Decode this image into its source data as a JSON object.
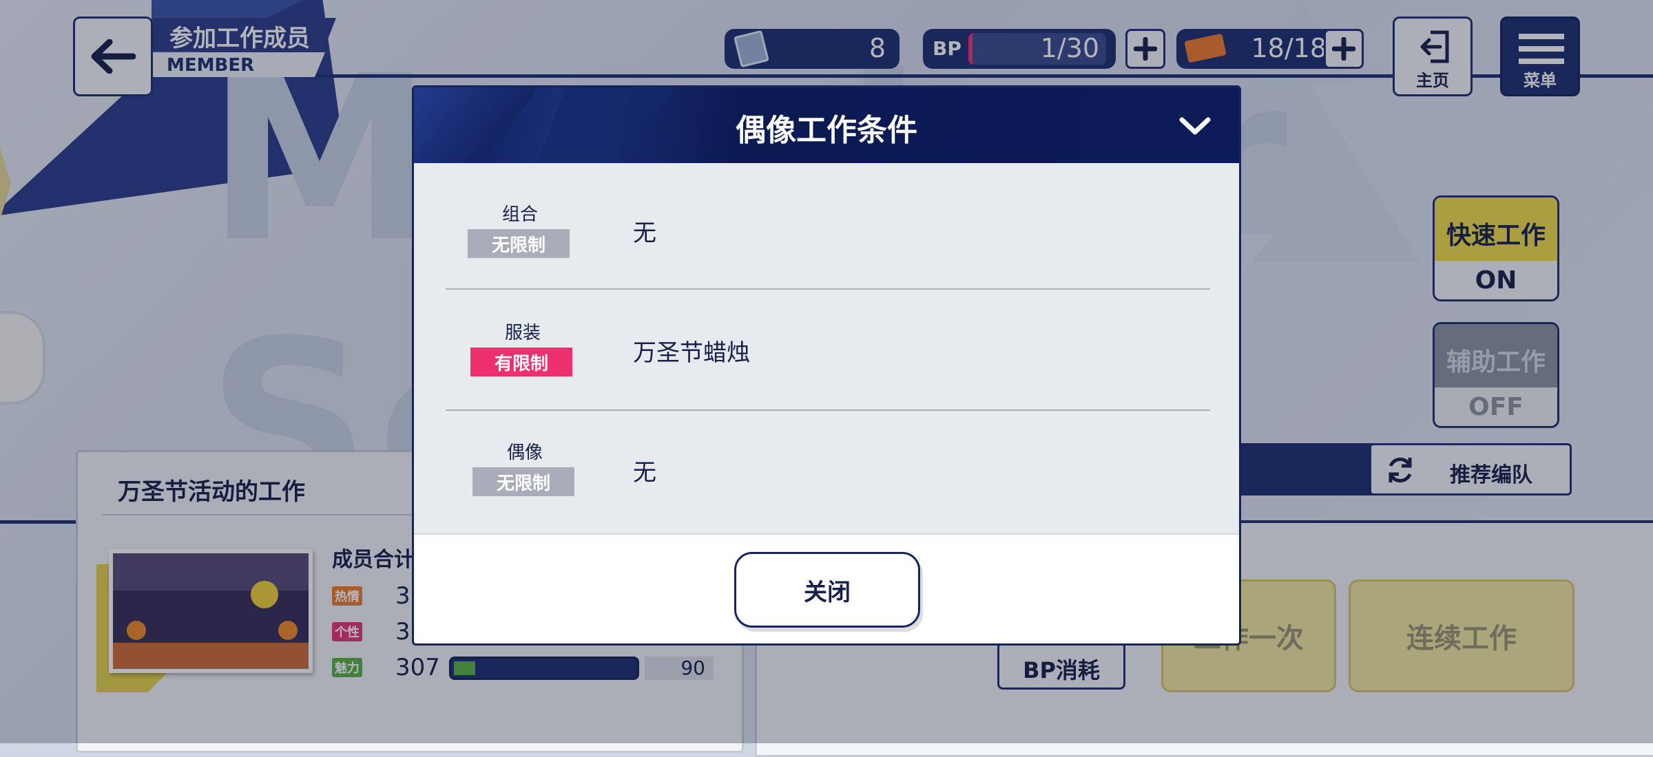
{
  "header": {
    "title": "参加工作成员",
    "subtitle": "MEMBER",
    "ticket_count": "8",
    "bp_label": "BP",
    "bp_value": "1/30",
    "work_value": "18/18",
    "home_label": "主页",
    "menu_label": "菜单"
  },
  "background": {
    "big_word": "Member Selec",
    "quick_work_label": "快速工作",
    "quick_work_state": "ON",
    "assist_work_label": "辅助工作",
    "assist_work_state": "OFF",
    "recommend_label": "推荐编队",
    "work_title": "万圣节活动的工作",
    "member_total_label": "成员合计",
    "stat_passion_label": "热情",
    "stat_passion_value": "3",
    "stat_personality_label": "个性",
    "stat_personality_value": "3",
    "stat_charm_label": "魅力",
    "stat_charm_value": "307",
    "stat_charm_target": "90",
    "stat_charm_fill": 0.12,
    "bp_cost_label": "BP消耗",
    "once_label": "工作一次",
    "continuous_label": "连续工作"
  },
  "modal": {
    "title": "偶像工作条件",
    "rows": [
      {
        "label": "组合",
        "chip": "无限制",
        "value": "无"
      },
      {
        "label": "服装",
        "chip": "有限制",
        "value": "万圣节蜡烛"
      },
      {
        "label": "偶像",
        "chip": "无限制",
        "value": "无"
      }
    ],
    "close_label": "关闭"
  },
  "colors": {
    "navy": "#16245c",
    "chip_unrestricted": "#a9adb9",
    "chip_restricted": "#ee2f6e",
    "quick_yellow": "#f2de4a",
    "passion": "#f07d2b",
    "personality": "#e8347a",
    "charm": "#5bb247"
  }
}
